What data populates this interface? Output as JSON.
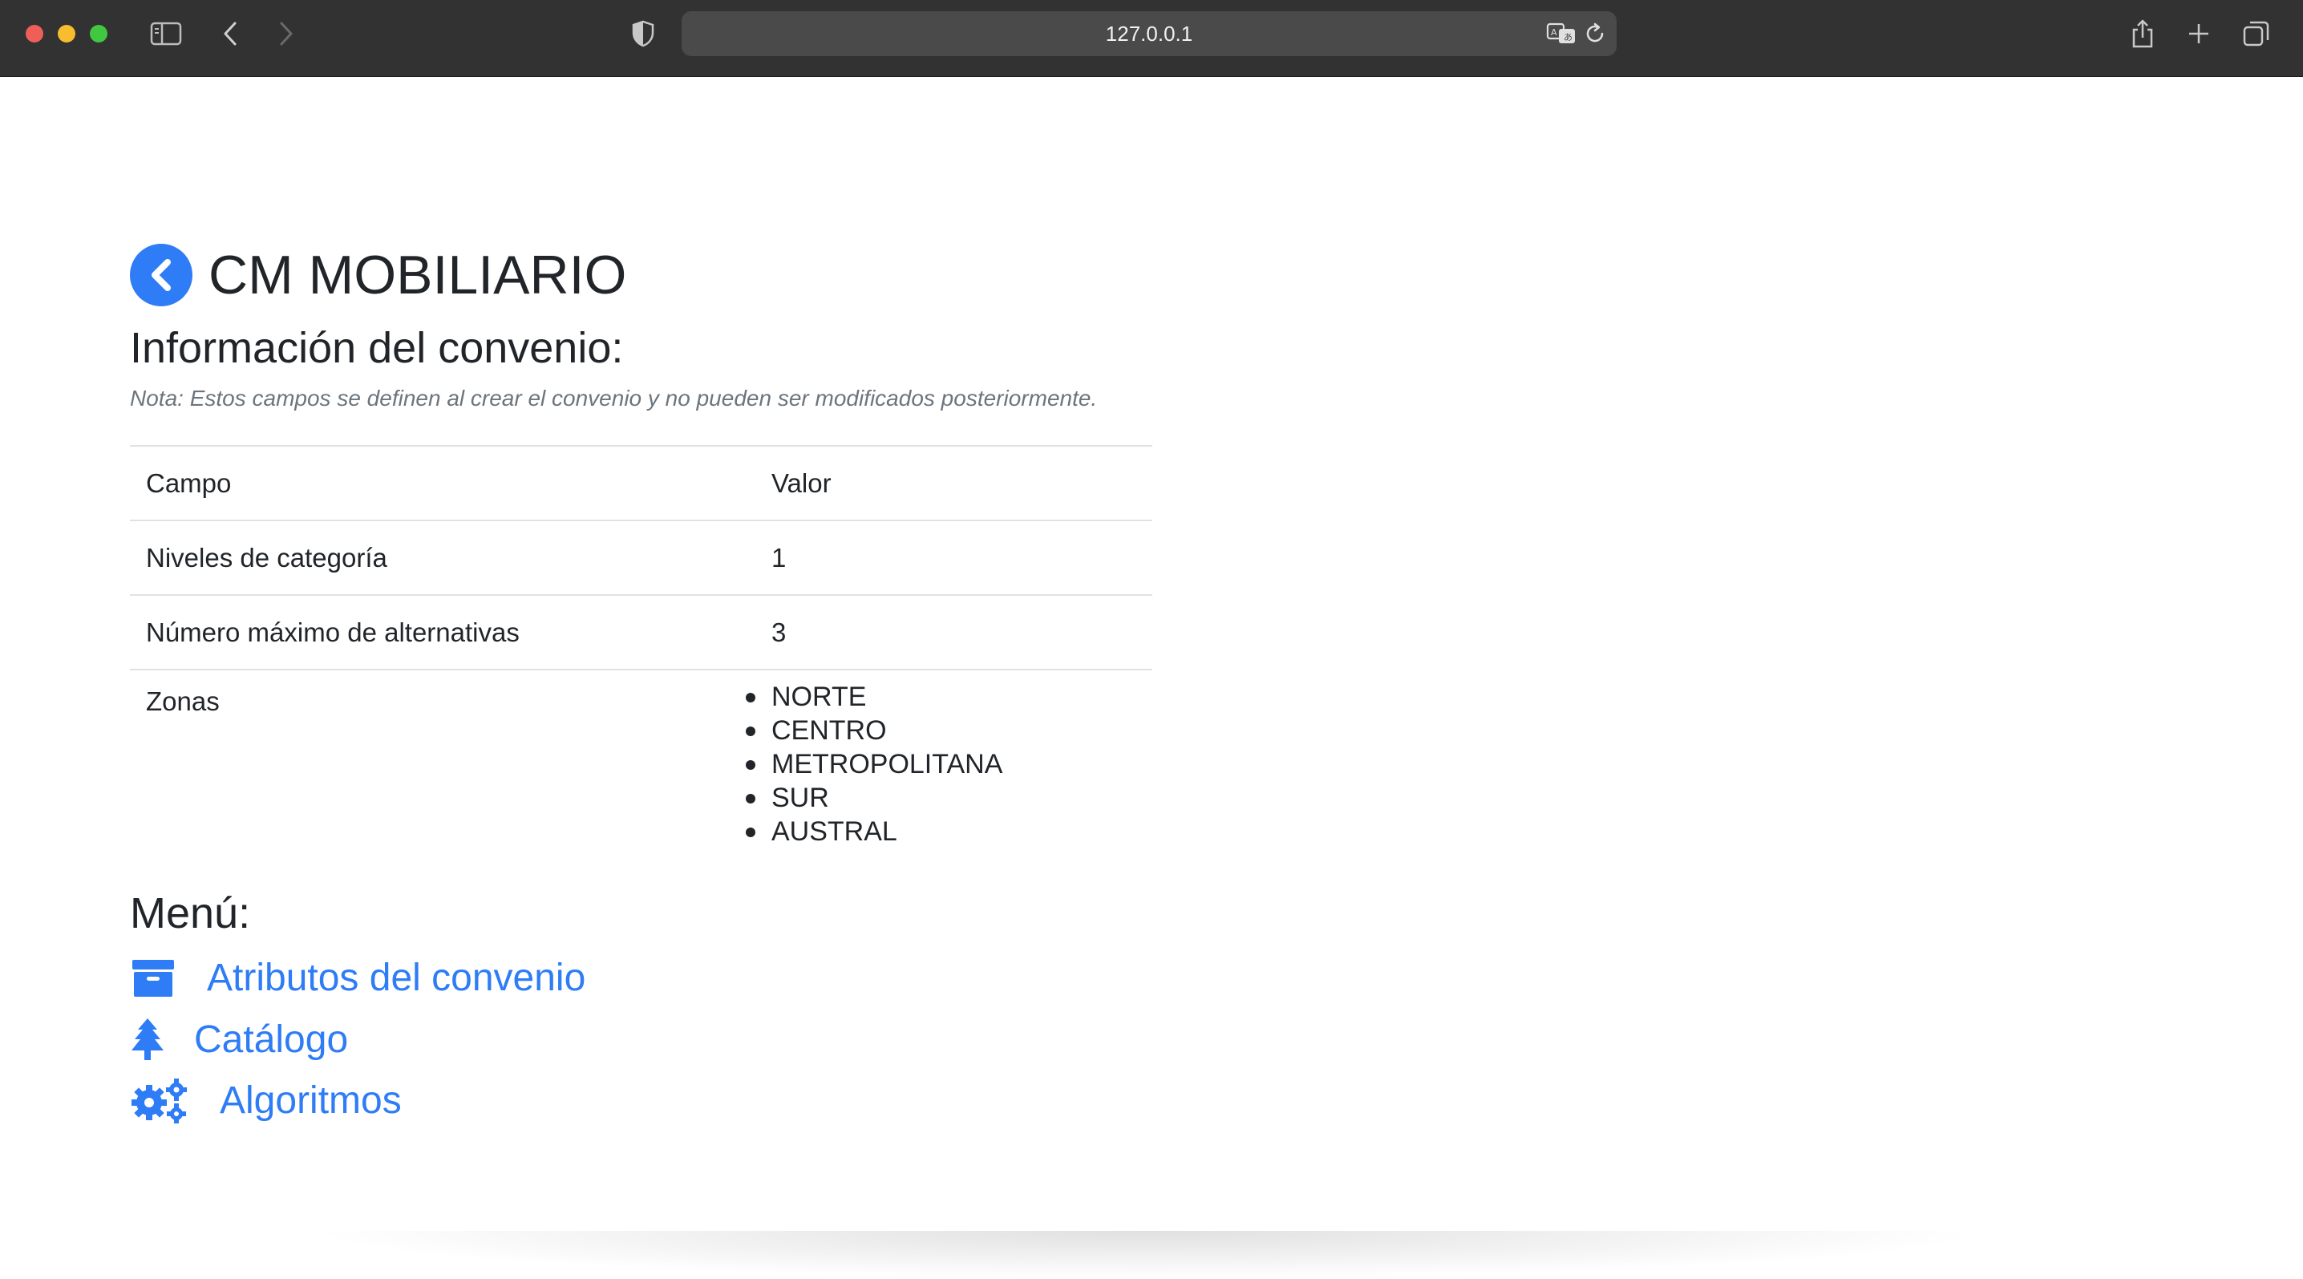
{
  "browser": {
    "url": "127.0.0.1",
    "icons": {
      "sidebar": "sidebar-icon",
      "back": "chevron-left-icon",
      "forward": "chevron-right-icon",
      "shield": "shield-icon",
      "translate": "translate-icon",
      "reload": "reload-icon",
      "share": "share-icon",
      "new_tab": "plus-icon",
      "tabs": "tabs-overview-icon"
    }
  },
  "header": {
    "title": "CM MOBILIARIO",
    "back_icon": "chevron-circle-left-icon"
  },
  "info": {
    "title": "Información del convenio:",
    "note": "Nota: Estos campos se definen al crear el convenio y no pueden ser modificados posteriormente.",
    "table": {
      "headers": [
        "Campo",
        "Valor"
      ],
      "rows": [
        {
          "field": "Niveles de categoría",
          "value": "1"
        },
        {
          "field": "Número máximo de alternativas",
          "value": "3"
        }
      ],
      "zones": {
        "field": "Zonas",
        "values": [
          "NORTE",
          "CENTRO",
          "METROPOLITANA",
          "SUR",
          "AUSTRAL"
        ]
      }
    }
  },
  "menu": {
    "title": "Menú:",
    "items": [
      {
        "label": "Atributos del convenio",
        "icon": "archive-icon"
      },
      {
        "label": "Catálogo",
        "icon": "tree-icon"
      },
      {
        "label": "Algoritmos",
        "icon": "gears-icon"
      }
    ]
  },
  "colors": {
    "accent": "#2e7cf6",
    "text": "#212529",
    "muted": "#6c757d",
    "chrome": "#323233"
  }
}
